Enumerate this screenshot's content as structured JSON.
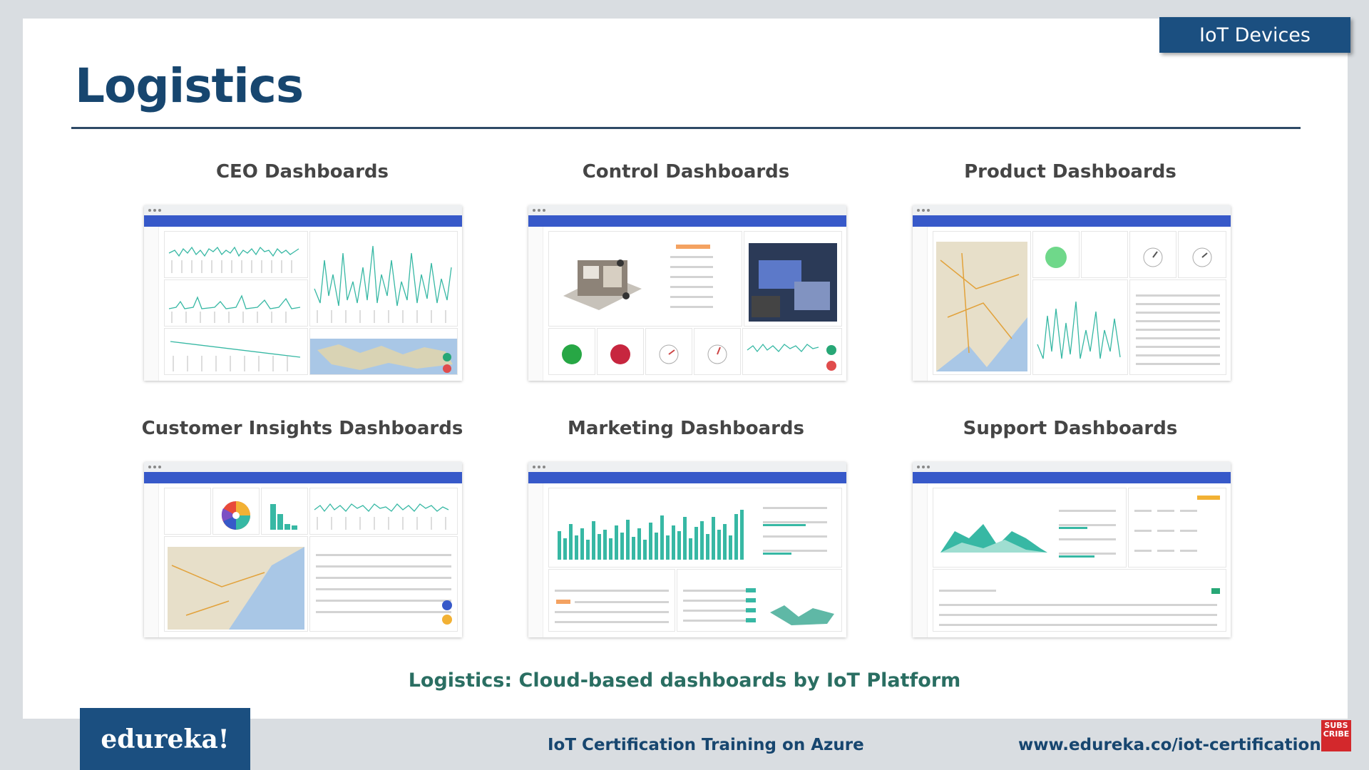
{
  "badge": "IoT Devices",
  "title": "Logistics",
  "dashboards": [
    {
      "caption": "CEO Dashboards"
    },
    {
      "caption": "Control Dashboards"
    },
    {
      "caption": "Product Dashboards"
    },
    {
      "caption": "Customer Insights Dashboards"
    },
    {
      "caption": "Marketing Dashboards"
    },
    {
      "caption": "Support Dashboards"
    }
  ],
  "caption": "Logistics: Cloud-based dashboards by IoT Platform",
  "footer": {
    "logo": "edureka!",
    "course": "IoT Certification Training on Azure",
    "url": "www.edureka.co/iot-certification-training"
  },
  "subscribe": "SUBS CRIBE",
  "colors": {
    "brand_blue": "#1b4f80",
    "title_blue": "#17466f",
    "caption_teal": "#2a6e62",
    "dashboard_bar": "#3759c9",
    "chart_teal": "#37b8a4"
  }
}
